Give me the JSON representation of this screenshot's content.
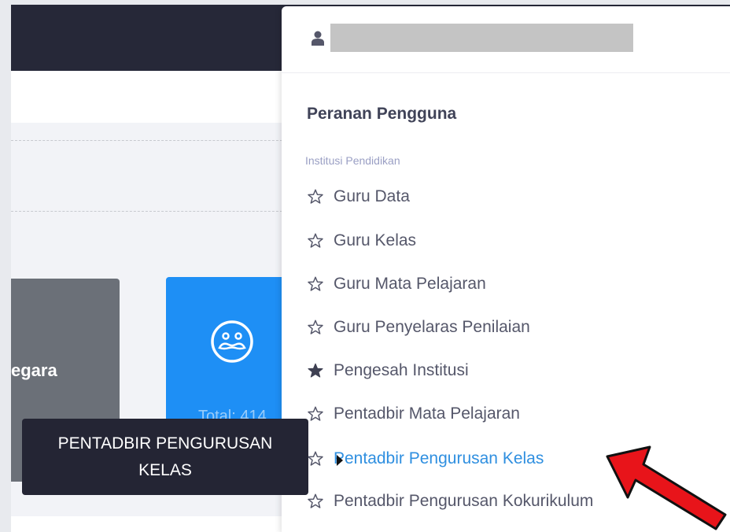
{
  "background": {
    "card_partial_text": "egara",
    "card_total_text": "Total: 414"
  },
  "user": {
    "name_redacted": ""
  },
  "menu": {
    "title": "Peranan Pengguna",
    "group_label": "Institusi Pendidikan",
    "roles": [
      {
        "label": "Guru Data",
        "starred": false
      },
      {
        "label": "Guru Kelas",
        "starred": false
      },
      {
        "label": "Guru Mata Pelajaran",
        "starred": false
      },
      {
        "label": "Guru Penyelaras Penilaian",
        "starred": false
      },
      {
        "label": "Pengesah Institusi",
        "starred": true
      },
      {
        "label": "Pentadbir Mata Pelajaran",
        "starred": false
      },
      {
        "label": "Pentadbir Pengurusan Kelas",
        "starred": false,
        "active": true
      },
      {
        "label": "Pentadbir Pengurusan Kokurikulum",
        "starred": false
      }
    ]
  },
  "tooltip": {
    "line1": "PENTADBIR PENGURUSAN",
    "line2": "KELAS"
  },
  "colors": {
    "active_link": "#2f8fe0",
    "annotation_arrow": "#e8141a",
    "card_blue": "#1e8ff5",
    "topbar": "#262838"
  }
}
